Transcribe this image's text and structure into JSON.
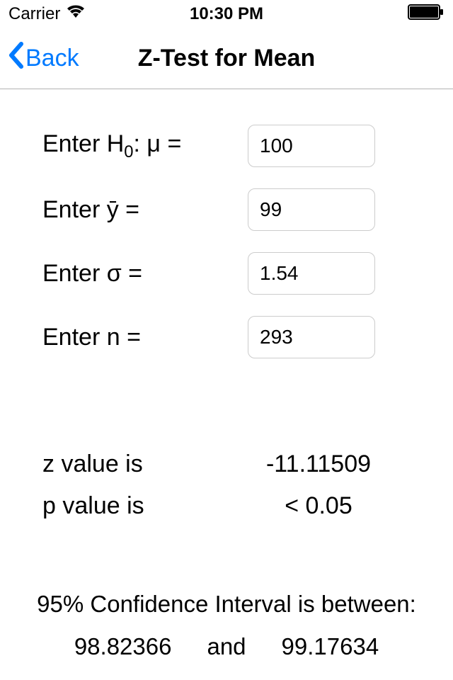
{
  "status": {
    "carrier": "Carrier",
    "time": "10:30 PM"
  },
  "nav": {
    "back_label": "Back",
    "title": "Z-Test for Mean"
  },
  "form": {
    "h0_label_prefix": "Enter H",
    "h0_label_sub": "0",
    "h0_label_suffix": ": μ =",
    "h0_value": "100",
    "ybar_label": "Enter ȳ =",
    "ybar_value": "99",
    "sigma_label": "Enter σ =",
    "sigma_value": "1.54",
    "n_label": "Enter n =",
    "n_value": "293"
  },
  "results": {
    "z_label": "z value is",
    "z_value": "-11.11509",
    "p_label": "p value is",
    "p_value": "< 0.05"
  },
  "ci": {
    "heading": "95% Confidence Interval is between:",
    "low": "98.82366",
    "and": "and",
    "high": "99.17634"
  }
}
